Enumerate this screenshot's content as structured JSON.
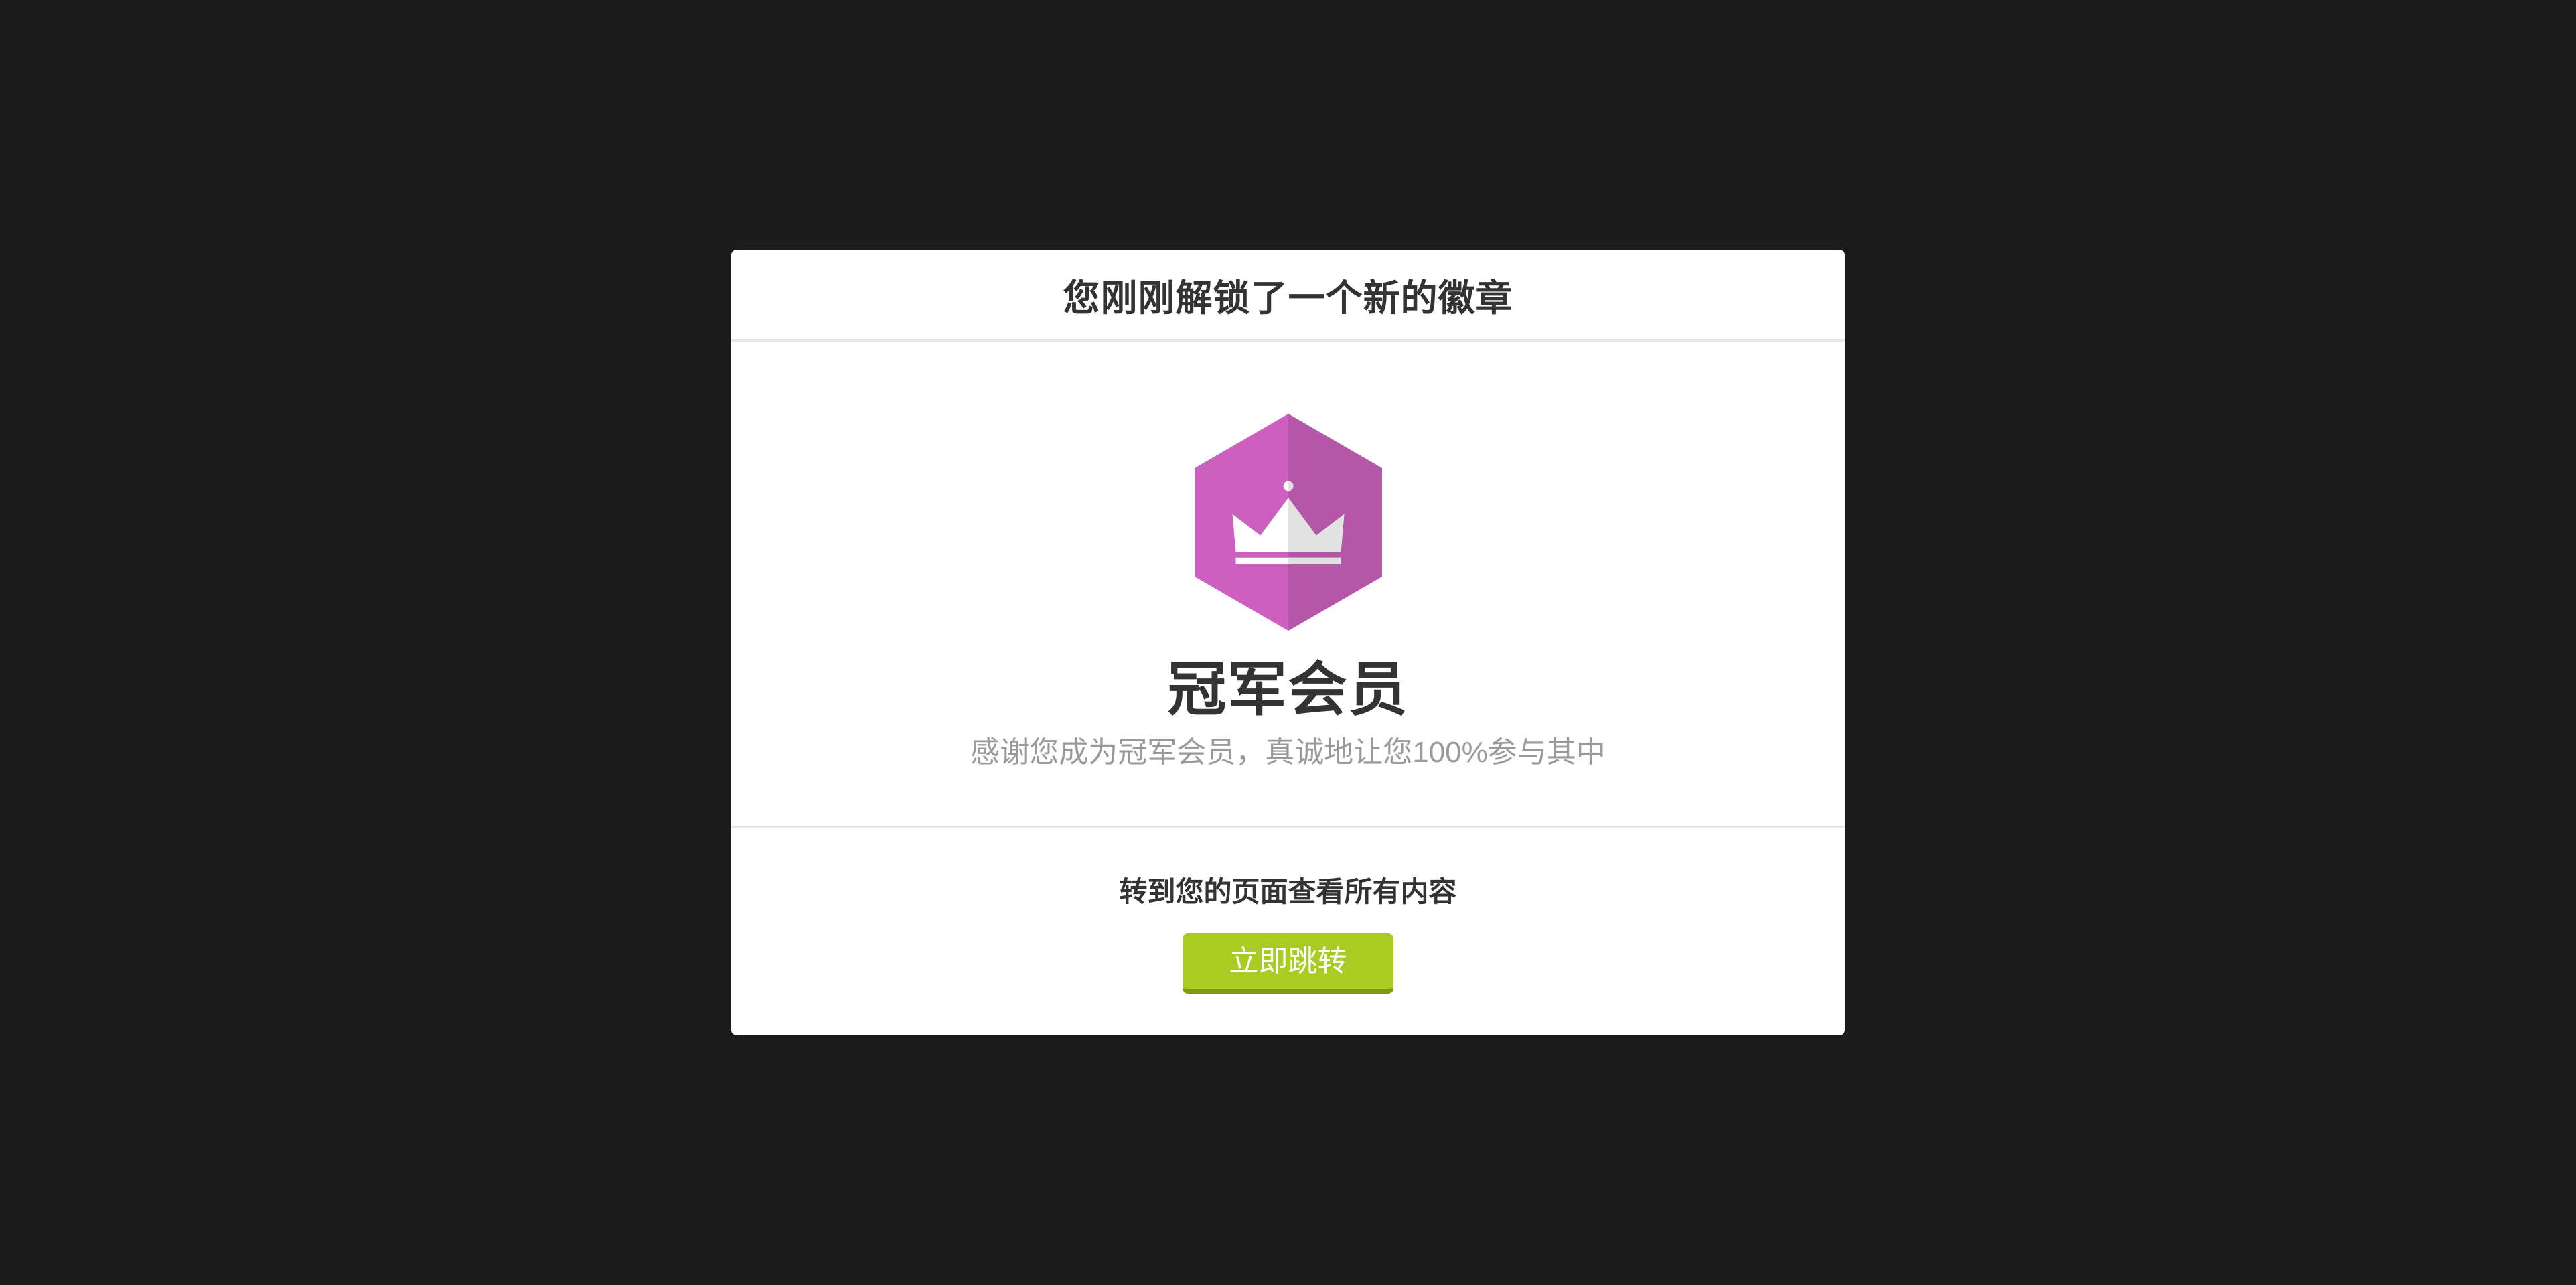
{
  "dialog": {
    "title": "您刚刚解锁了一个新的徽章"
  },
  "badge": {
    "icon": "crown-icon",
    "shape": "hexagon",
    "colors": {
      "hex_left": "#cc5fc0",
      "hex_right": "#b457a8",
      "crown_left": "#ffffff",
      "crown_right": "#e2e2e2"
    },
    "name": "冠军会员",
    "description": "感谢您成为冠军会员，真诚地让您100%参与其中"
  },
  "footer": {
    "prompt": "转到您的页面查看所有内容",
    "button_label": "立即跳转",
    "button_color": "#a8cc22"
  },
  "colors": {
    "backdrop": "#1b1b1b",
    "panel": "#ffffff"
  }
}
